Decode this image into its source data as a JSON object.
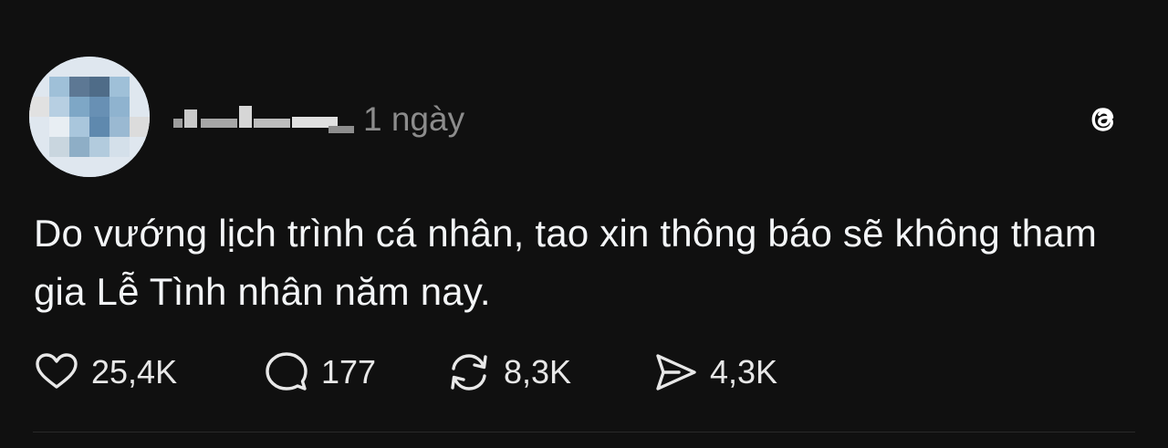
{
  "post": {
    "timestamp": "1 ngày",
    "text": "Do vướng lịch trình cá nhân, tao xin thông báo sẽ không tham gia Lễ Tình nhân năm nay.",
    "actions": {
      "likes": "25,4K",
      "replies": "177",
      "reposts": "8,3K",
      "shares": "4,3K"
    }
  },
  "icons": {
    "avatar": "avatar-image",
    "like": "heart-icon",
    "reply": "comment-icon",
    "repost": "repost-icon",
    "share": "send-icon",
    "brand": "threads-logo-icon"
  },
  "colors": {
    "background": "#101010",
    "text": "#f3f5f7",
    "muted": "#8c8c8c"
  }
}
